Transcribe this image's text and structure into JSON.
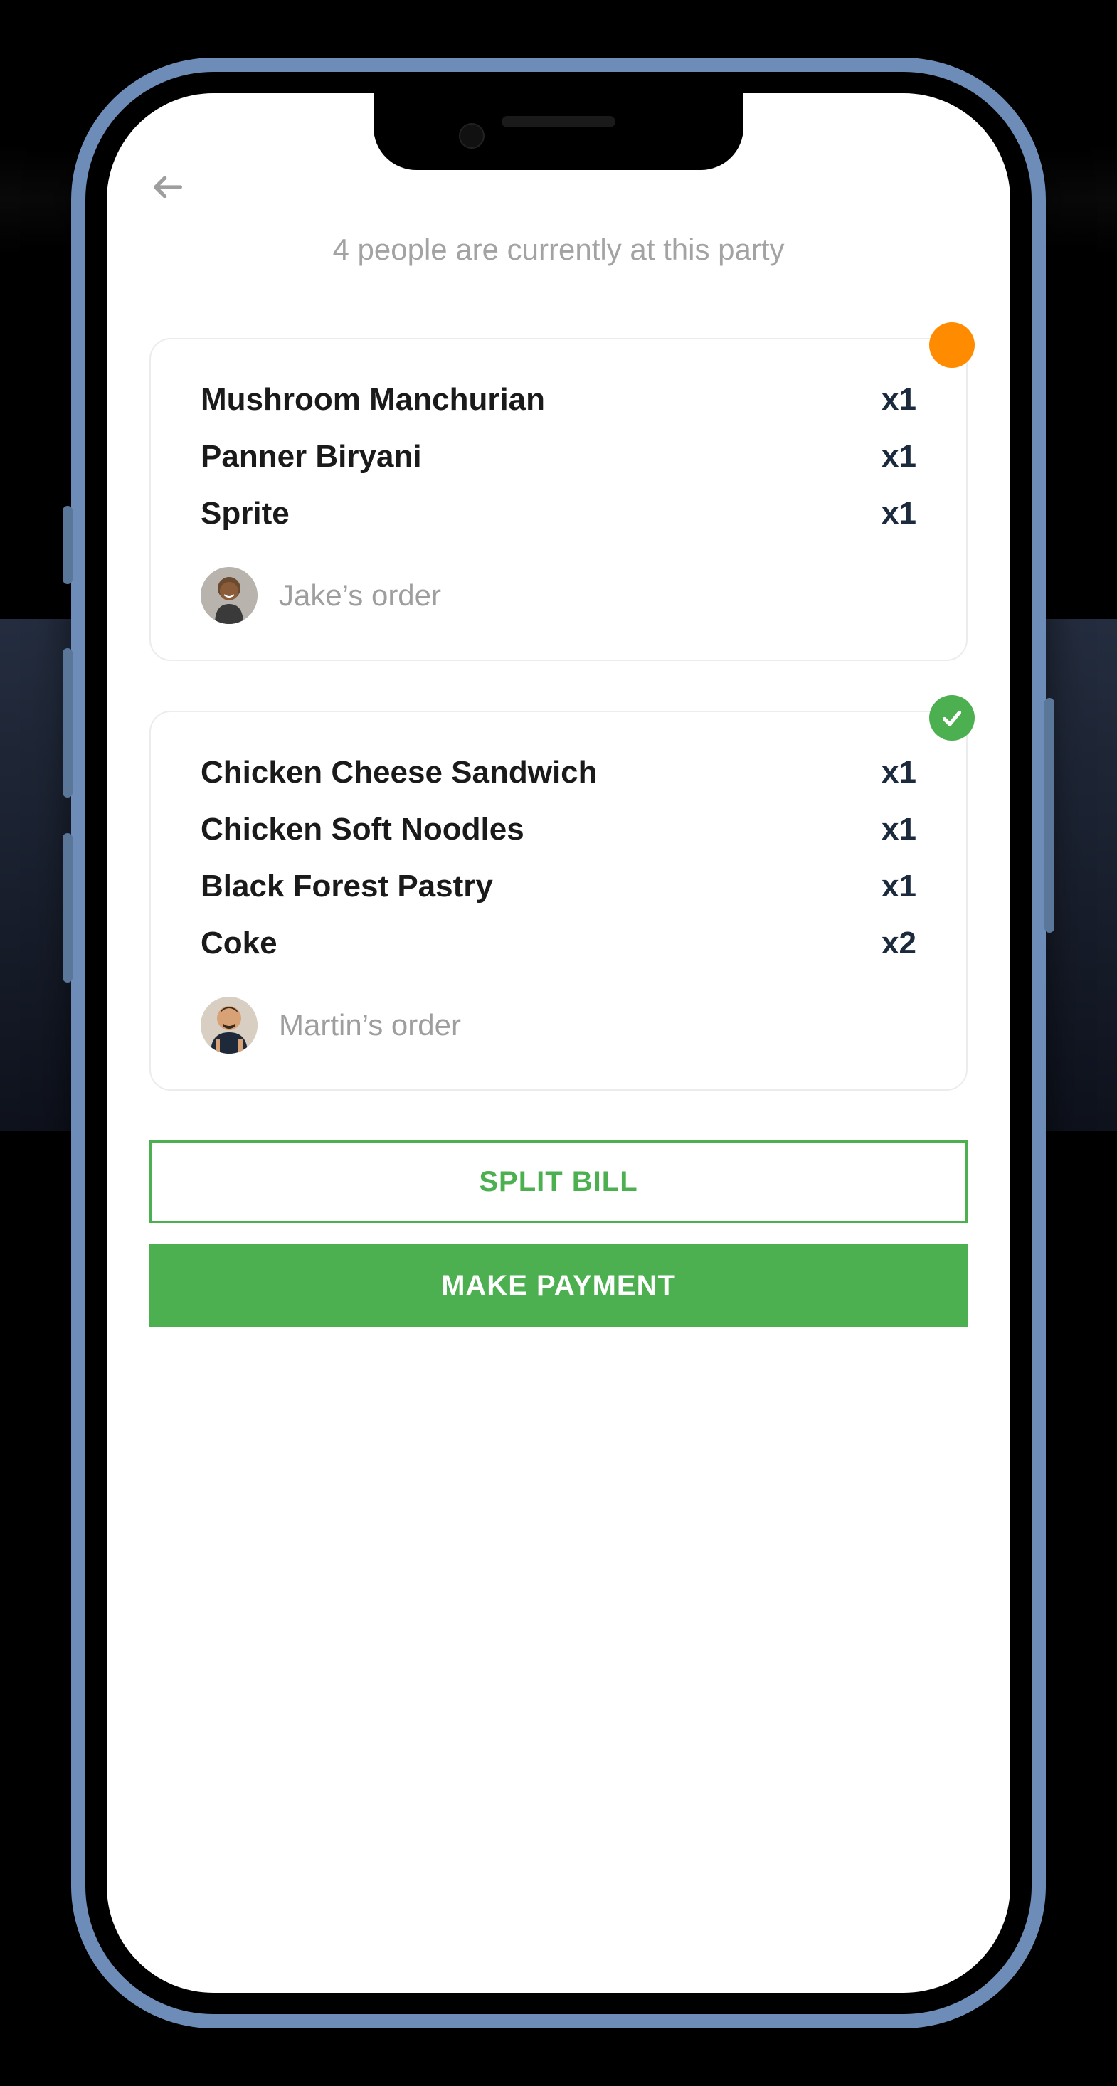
{
  "subtitle": "4 people are currently at this party",
  "orders": [
    {
      "status": "pending",
      "items": [
        {
          "name": "Mushroom Manchurian",
          "qty": "x1"
        },
        {
          "name": "Panner Biryani",
          "qty": "x1"
        },
        {
          "name": "Sprite",
          "qty": "x1"
        }
      ],
      "owner_label": "Jake’s order",
      "avatar_svg": "jake"
    },
    {
      "status": "done",
      "items": [
        {
          "name": "Chicken Cheese Sandwich",
          "qty": "x1"
        },
        {
          "name": "Chicken Soft Noodles",
          "qty": "x1"
        },
        {
          "name": "Black Forest Pastry",
          "qty": "x1"
        },
        {
          "name": "Coke",
          "qty": "x2"
        }
      ],
      "owner_label": "Martin’s order",
      "avatar_svg": "martin"
    }
  ],
  "buttons": {
    "split_bill": "SPLIT BILL",
    "make_payment": "MAKE PAYMENT"
  },
  "colors": {
    "accent": "#4caf50",
    "pending": "#ff8c00"
  }
}
